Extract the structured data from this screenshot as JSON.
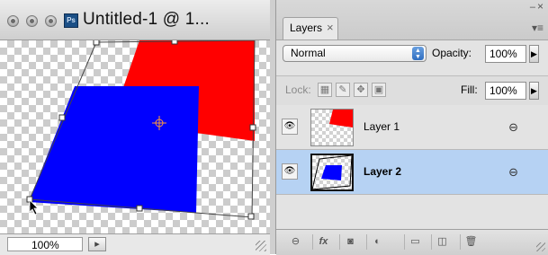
{
  "document": {
    "title": "Untitled-1 @ 1...",
    "app_icon_label": "Ps",
    "zoom": "100%",
    "colors": {
      "layer1_fill": "#ff0000",
      "layer2_fill": "#0000ff",
      "bbox": "#555555"
    }
  },
  "layers_panel": {
    "tab_label": "Layers",
    "tab_close": "×",
    "minimize": "–",
    "close": "×",
    "menu": "▾≡",
    "blend_mode": "Normal",
    "opacity_label": "Opacity:",
    "opacity_value": "100%",
    "lock_label": "Lock:",
    "fill_label": "Fill:",
    "fill_value": "100%",
    "layers": [
      {
        "name": "Layer 1",
        "selected": false,
        "visible": true
      },
      {
        "name": "Layer 2",
        "selected": true,
        "visible": true
      }
    ],
    "selected_color": "#b6d2f3",
    "footer_icons": [
      "link-icon",
      "fx-icon",
      "mask-icon",
      "adjustment-icon",
      "folder-icon",
      "new-layer-icon",
      "trash-icon"
    ],
    "footer_labels": [
      "⊖",
      "fx",
      "◙",
      "◐",
      "▭",
      "◫",
      "🗑"
    ]
  }
}
